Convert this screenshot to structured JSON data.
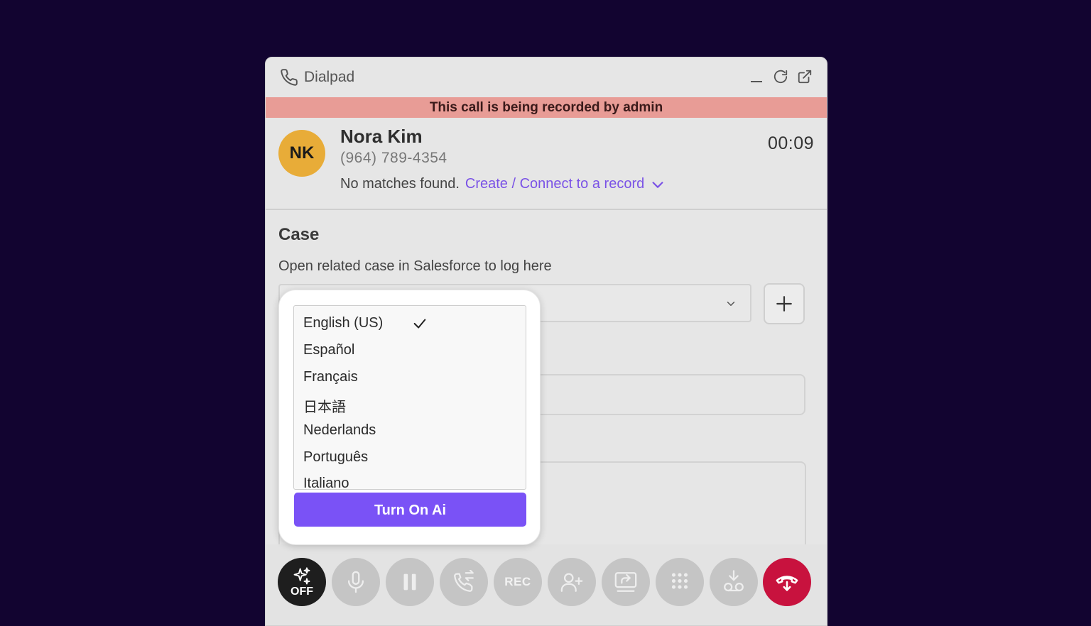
{
  "window": {
    "title": "Dialpad",
    "recording_banner": "This call is being recorded by admin"
  },
  "contact": {
    "initials": "NK",
    "name": "Nora Kim",
    "phone": "(964) 789-4354",
    "timer": "00:09",
    "no_match_text": "No matches found.",
    "link_text": "Create / Connect to a record"
  },
  "case": {
    "title": "Case",
    "hint": "Open related case in Salesforce to log here"
  },
  "language_menu": {
    "items": [
      "English (US)",
      "Español",
      "Français",
      "日本語",
      "Nederlands",
      "Português",
      "Italiano"
    ],
    "selected": "English (US)",
    "button_label": "Turn On Ai"
  },
  "toolbar": {
    "ai_label": "OFF",
    "rec_label": "REC"
  },
  "colors": {
    "accent": "#7a52f6",
    "banner": "#e89c96",
    "avatar": "#e8ac38",
    "hangup": "#c8123e",
    "background": "#120430"
  }
}
